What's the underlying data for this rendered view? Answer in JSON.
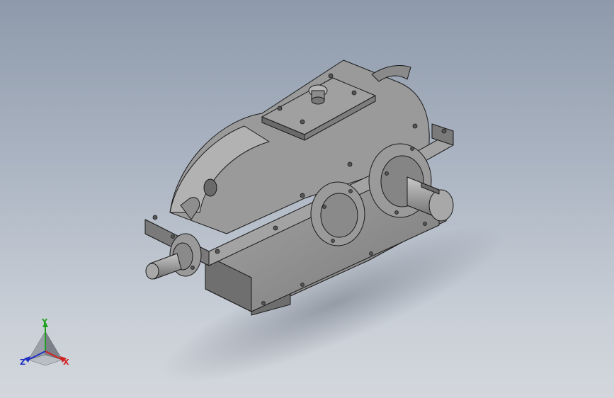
{
  "triad": {
    "y_label": "Y",
    "z_label": "Z",
    "x_label": "X"
  },
  "colors": {
    "background_top": "#8e9aab",
    "background_bottom": "#d3d7dd",
    "model_body": "#8c8c8c",
    "model_dark": "#5e5e5e",
    "model_light": "#b0b0b0",
    "edge": "#1a1a1a",
    "axis_x": "#d02020",
    "axis_y": "#20a020",
    "axis_z": "#2030c0"
  },
  "model": {
    "name_icon": "gear-reducer-model"
  }
}
